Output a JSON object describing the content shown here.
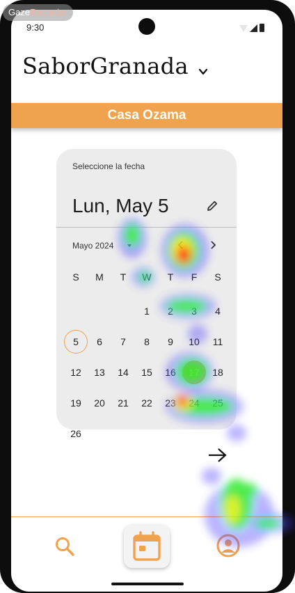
{
  "overlay": {
    "brand_a": "Gaze",
    "brand_b": "Recorder"
  },
  "status_bar": {
    "time": "9:30"
  },
  "header": {
    "app_title": "SaborGranada",
    "menu_icon": "chevron-down-icon"
  },
  "banner": {
    "restaurant": "Casa Ozama",
    "color": "#f0a24e"
  },
  "date_picker": {
    "prompt": "Seleccione la fecha",
    "selected_display": "Lun, May 5",
    "month_label": "Mayo 2024",
    "weekdays": [
      "S",
      "M",
      "T",
      "W",
      "T",
      "F",
      "S"
    ],
    "leading_blanks": 3,
    "days": [
      "1",
      "2",
      "3",
      "4",
      "5",
      "6",
      "7",
      "8",
      "9",
      "10",
      "11",
      "12",
      "13",
      "14",
      "15",
      "16",
      "17",
      "18",
      "19",
      "20",
      "21",
      "22",
      "23",
      "24",
      "25",
      "26"
    ],
    "today_day": "5",
    "highlighted_day": "17"
  },
  "bottom_nav": {
    "items": [
      {
        "icon": "search-icon",
        "active": false
      },
      {
        "icon": "calendar-icon",
        "active": true
      },
      {
        "icon": "profile-icon",
        "active": false
      }
    ]
  }
}
